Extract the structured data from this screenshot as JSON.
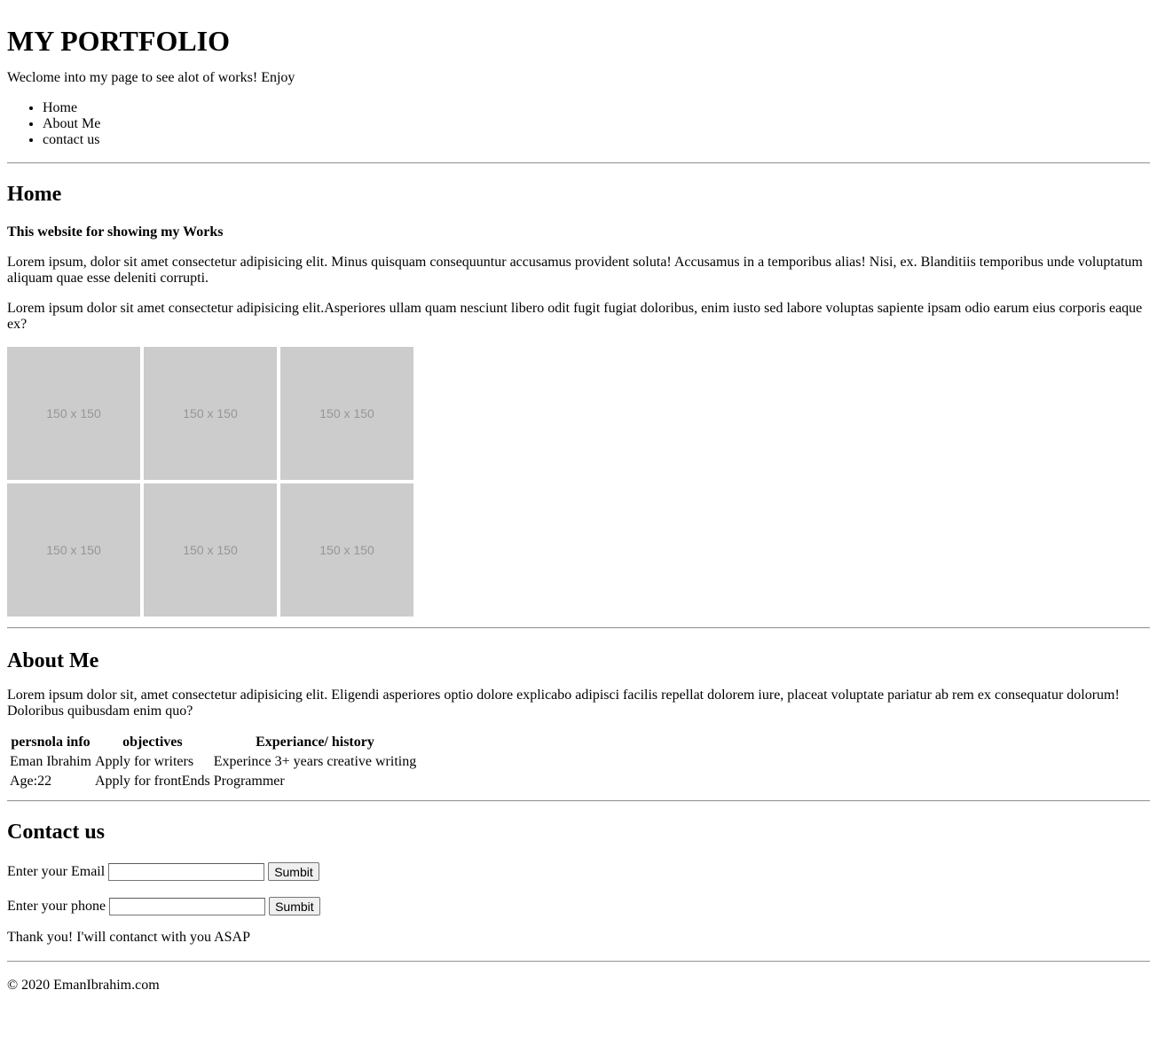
{
  "header": {
    "title": "MY PORTFOLIO",
    "intro": "Weclome into my page to see alot of works! Enjoy",
    "nav": [
      "Home",
      "About Me",
      "contact us"
    ]
  },
  "home": {
    "title": "Home",
    "subtitle": "This website for showing my Works",
    "paragraphs": [
      "Lorem ipsum, dolor sit amet consectetur adipisicing elit. Minus quisquam consequuntur accusamus provident soluta! Accusamus in a temporibus alias! Nisi, ex. Blanditiis temporibus unde voluptatum aliquam quae esse deleniti corrupti.",
      "Lorem ipsum dolor sit amet consectetur adipisicing elit.Asperiores ullam quam nesciunt libero odit fugit fugiat doloribus, enim iusto sed labore voluptas sapiente ipsam odio earum eius corporis eaque ex?"
    ],
    "gallery": [
      "150 x 150",
      "150 x 150",
      "150 x 150",
      "150 x 150",
      "150 x 150",
      "150 x 150"
    ]
  },
  "about": {
    "title": "About Me",
    "text": "Lorem ipsum dolor sit, amet consectetur adipisicing elit. Eligendi asperiores optio dolore explicabo adipisci facilis repellat dolorem iure, placeat voluptate pariatur ab rem ex consequatur dolorum! Doloribus quibusdam enim quo?",
    "table": {
      "headers": [
        "persnola info",
        "objectives",
        "Experiance/ history"
      ],
      "rows": [
        [
          "Eman Ibrahim",
          "Apply for writers",
          "Experince 3+ years creative writing"
        ],
        [
          "Age:22",
          "Apply for frontEnds",
          "Programmer"
        ]
      ]
    }
  },
  "contact": {
    "title": "Contact us",
    "email_label": "Enter your Email",
    "email_value": "",
    "phone_label": "Enter your phone",
    "phone_value": "",
    "submit_label": "Sumbit",
    "thanks": "Thank you! I'will contanct with you ASAP"
  },
  "footer": {
    "text": "© 2020 EmanIbrahim.com"
  }
}
